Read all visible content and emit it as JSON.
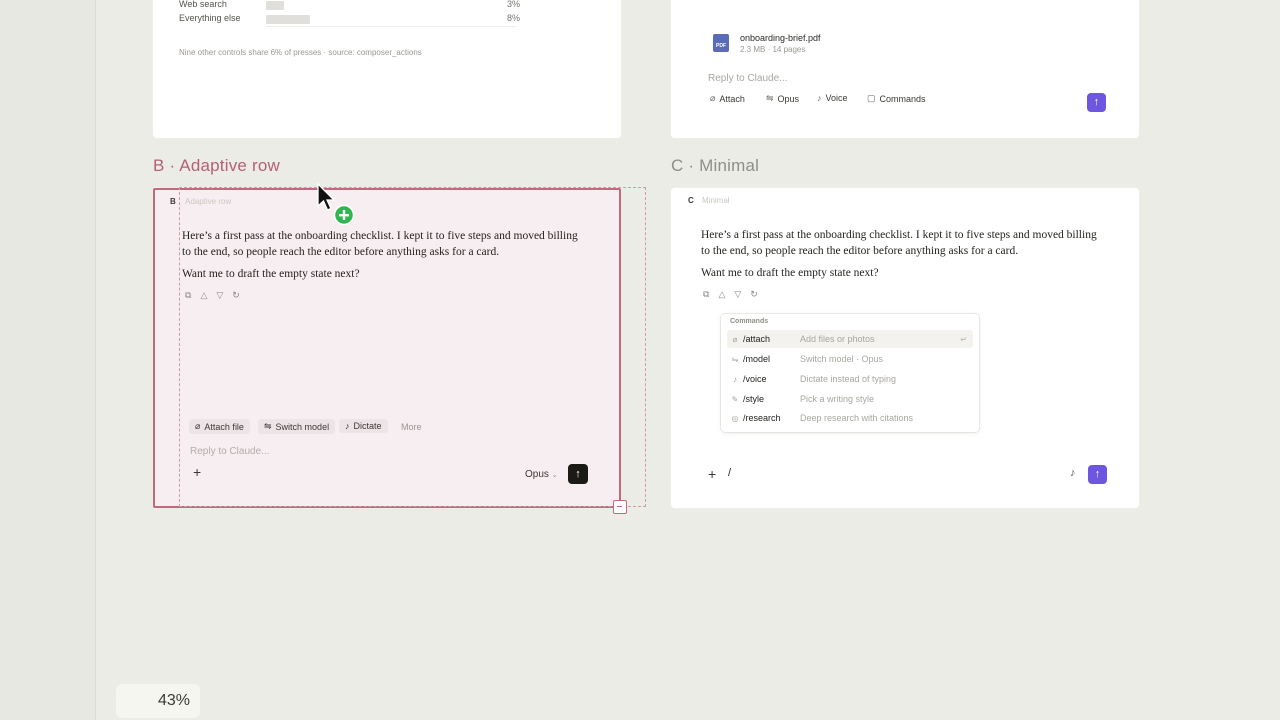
{
  "zoom": {
    "value": "43%"
  },
  "cardA": {
    "rows": [
      {
        "label": "Web search",
        "value": "3%",
        "fraction": 0.05
      },
      {
        "label": "Everything else",
        "value": "8%",
        "fraction": 0.13
      }
    ],
    "footnote": "Nine other controls share 6% of presses · source: composer_actions"
  },
  "cardTR": {
    "file_name": "onboarding-brief.pdf",
    "file_meta": "2.3 MB · 14 pages",
    "file_badge": "PDF",
    "placeholder": "Reply to Claude...",
    "toolbar": [
      "Attach",
      "Opus",
      "Voice",
      "Commands"
    ],
    "send": "↑"
  },
  "sectionB": {
    "title": "B · Adaptive row",
    "badge": "B",
    "label": "Adaptive row",
    "paragraph": "Here’s a first pass at the onboarding checklist. I kept it to five steps and moved billing to the end, so people reach the editor before anything asks for a card.",
    "question": "Want me to draft the empty state next?",
    "chips": [
      "Attach file",
      "Switch model",
      "Dictate"
    ],
    "more": "More",
    "placeholder": "Reply to Claude...",
    "plus": "+",
    "model": "Opus",
    "send": "↑"
  },
  "sectionC": {
    "title": "C · Minimal",
    "badge": "C",
    "label": "Minimal",
    "paragraph": "Here’s a first pass at the onboarding checklist. I kept it to five steps and moved billing to the end, so people reach the editor before anything asks for a card.",
    "question": "Want me to draft the empty state next?",
    "menu_title": "Commands",
    "commands": [
      {
        "cmd": "/attach",
        "desc": "Add files or photos"
      },
      {
        "cmd": "/model",
        "desc": "Switch model · Opus"
      },
      {
        "cmd": "/voice",
        "desc": "Dictate instead of typing"
      },
      {
        "cmd": "/style",
        "desc": "Pick a writing style"
      },
      {
        "cmd": "/research",
        "desc": "Deep research with citations"
      }
    ],
    "plus": "+",
    "input_value": "/",
    "send": "↑"
  },
  "colors": {
    "accent_pink": "#c0697f",
    "purple": "#6e56e0",
    "title_active": "#b4607a"
  }
}
